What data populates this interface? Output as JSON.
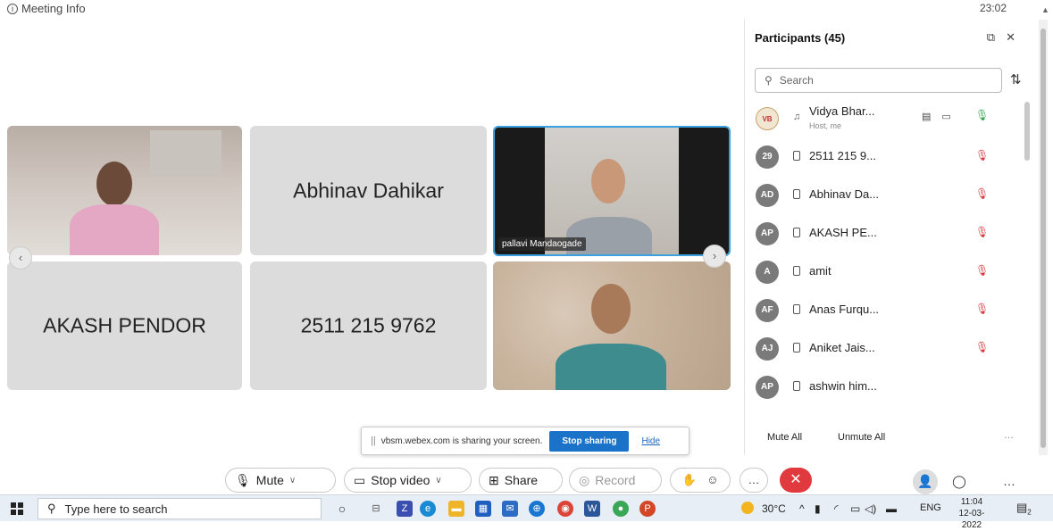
{
  "topbar": {
    "meeting_info": "Meeting Info",
    "clock": "23:02"
  },
  "tiles": {
    "video1": {
      "name": ""
    },
    "abhinav": {
      "name": "Abhinav Dahikar"
    },
    "pallavi": {
      "name": "pallavi Mandaogade"
    },
    "akash": {
      "name": "AKASH PENDOR"
    },
    "phone": {
      "name": "2511 215 9762"
    },
    "video4": {
      "name": ""
    }
  },
  "share_banner": {
    "message": "vbsm.webex.com is sharing your screen.",
    "stop_label": "Stop sharing",
    "hide_label": "Hide"
  },
  "controls": {
    "mute": "Mute",
    "stop_video": "Stop video",
    "share": "Share",
    "record": "Record"
  },
  "participants": {
    "title": "Participants (45)",
    "search_placeholder": "Search",
    "rows": [
      {
        "initials": "",
        "name": "Vidya Bhar...",
        "sub": "Host, me",
        "host": true
      },
      {
        "initials": "29",
        "name": "2511 215 9...",
        "sub": ""
      },
      {
        "initials": "AD",
        "name": "Abhinav Da...",
        "sub": ""
      },
      {
        "initials": "AP",
        "name": "AKASH PE...",
        "sub": ""
      },
      {
        "initials": "A",
        "name": "amit",
        "sub": ""
      },
      {
        "initials": "AF",
        "name": "Anas Furqu...",
        "sub": ""
      },
      {
        "initials": "AJ",
        "name": "Aniket Jais...",
        "sub": ""
      },
      {
        "initials": "AP",
        "name": "ashwin him...",
        "sub": ""
      }
    ],
    "mute_all": "Mute All",
    "unmute_all": "Unmute All"
  },
  "taskbar": {
    "search_text": "Type here to search",
    "weather": "30°C",
    "lang": "ENG",
    "time": "11:04",
    "date": "12-03-2022",
    "notifications": "2"
  }
}
